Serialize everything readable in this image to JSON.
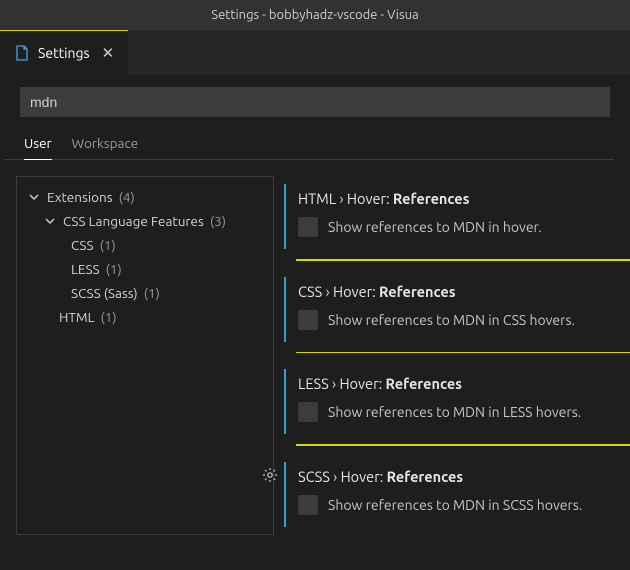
{
  "window_title": "Settings - bobbyhadz-vscode - Visua",
  "tab": {
    "label": "Settings"
  },
  "search": {
    "value": "mdn"
  },
  "scopes": {
    "user": "User",
    "workspace": "Workspace"
  },
  "tree": {
    "root_label": "Extensions",
    "root_count": "(4)",
    "css_features_label": "CSS Language Features",
    "css_features_count": "(3)",
    "css_label": "CSS",
    "css_count": "(1)",
    "less_label": "LESS",
    "less_count": "(1)",
    "scss_label": "SCSS (Sass)",
    "scss_count": "(1)",
    "html_label": "HTML",
    "html_count": "(1)"
  },
  "settings": {
    "html": {
      "cat": "HTML",
      "sub": "Hover:",
      "name": "References",
      "desc": "Show references to MDN in hover."
    },
    "css": {
      "cat": "CSS",
      "sub": "Hover:",
      "name": "References",
      "desc": "Show references to MDN in CSS hovers."
    },
    "less": {
      "cat": "LESS",
      "sub": "Hover:",
      "name": "References",
      "desc": "Show references to MDN in LESS hovers."
    },
    "scss": {
      "cat": "SCSS",
      "sub": "Hover:",
      "name": "References",
      "desc": "Show references to MDN in SCSS hovers."
    }
  },
  "sep": "›"
}
